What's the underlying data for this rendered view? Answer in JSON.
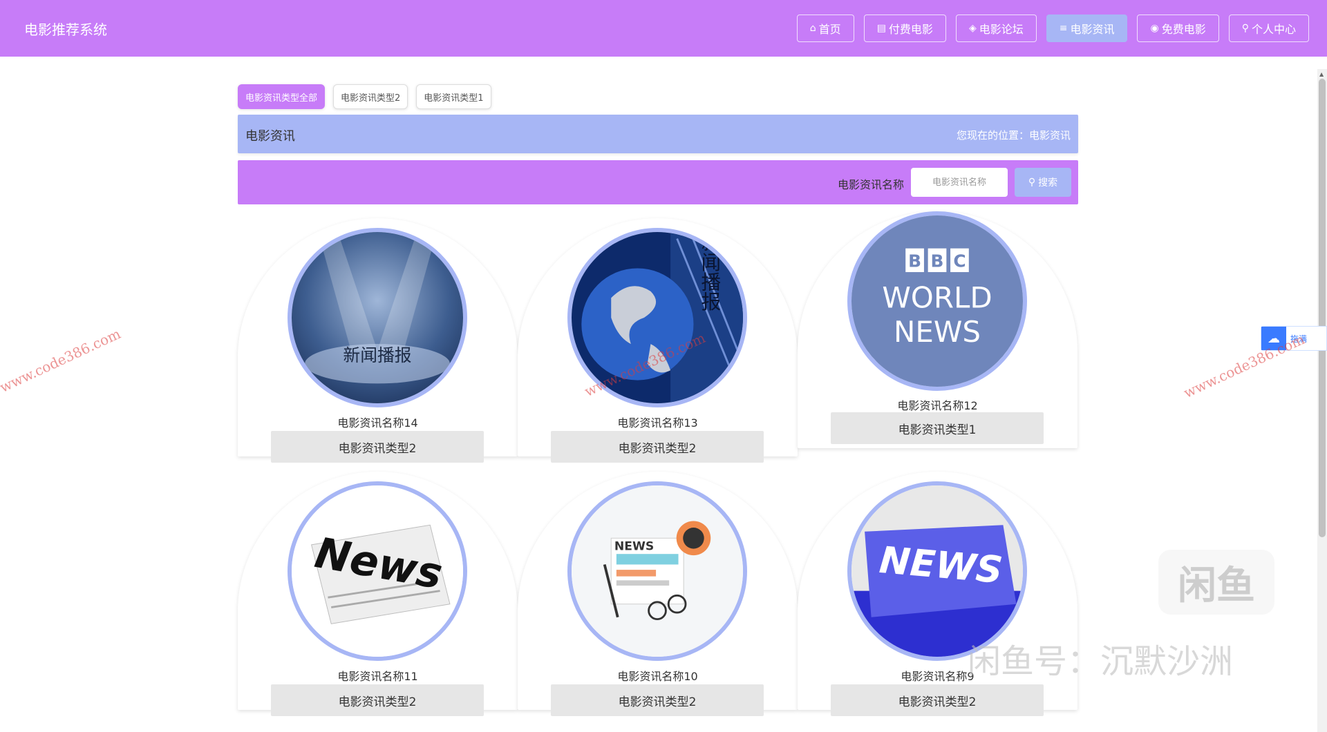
{
  "header": {
    "title": "电影推荐系统",
    "nav": [
      {
        "icon": "⌂",
        "label": "首页",
        "active": false
      },
      {
        "icon": "▤",
        "label": "付费电影",
        "active": false
      },
      {
        "icon": "◈",
        "label": "电影论坛",
        "active": false
      },
      {
        "icon": "≡",
        "label": "电影资讯",
        "active": true
      },
      {
        "icon": "◉",
        "label": "免费电影",
        "active": false
      },
      {
        "icon": "⚲",
        "label": "个人中心",
        "active": false
      }
    ]
  },
  "tabs": [
    {
      "label": "电影资讯类型全部",
      "active": true
    },
    {
      "label": "电影资讯类型2",
      "active": false
    },
    {
      "label": "电影资讯类型1",
      "active": false
    }
  ],
  "breadcrumb": {
    "title": "电影资讯",
    "position": "您现在的位置：电影资讯"
  },
  "search": {
    "label": "电影资讯名称",
    "placeholder": "电影资讯名称",
    "button": "搜索"
  },
  "cards": [
    {
      "name": "电影资讯名称14",
      "type": "电影资讯类型2",
      "image_text": "新闻播报"
    },
    {
      "name": "电影资讯名称13",
      "type": "电影资讯类型2",
      "image_text": "新闻播报"
    },
    {
      "name": "电影资讯名称12",
      "type": "电影资讯类型1",
      "image_text": "BBC WORLD NEWS"
    },
    {
      "name": "电影资讯名称11",
      "type": "电影资讯类型2",
      "image_text": "News"
    },
    {
      "name": "电影资讯名称10",
      "type": "电影资讯类型2",
      "image_text": "NEWS"
    },
    {
      "name": "电影资讯名称9",
      "type": "电影资讯类型2",
      "image_text": "NEWS"
    }
  ],
  "float_widget": {
    "label": "拖满"
  },
  "watermarks": {
    "site": "www.code386.com",
    "logo": "闲鱼",
    "text": "闲鱼号：沉默沙洲"
  },
  "colors": {
    "primary": "#c77cf8",
    "secondary": "#a7b6f5",
    "card_type_bg": "#e6e6e6"
  }
}
